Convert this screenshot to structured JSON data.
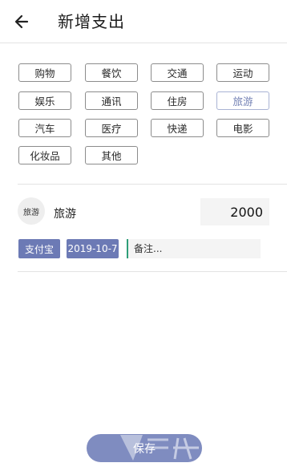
{
  "header": {
    "title": "新增支出",
    "back_icon": "arrow-left-icon"
  },
  "categories": [
    {
      "label": "购物",
      "selected": false
    },
    {
      "label": "餐饮",
      "selected": false
    },
    {
      "label": "交通",
      "selected": false
    },
    {
      "label": "运动",
      "selected": false
    },
    {
      "label": "娱乐",
      "selected": false
    },
    {
      "label": "通讯",
      "selected": false
    },
    {
      "label": "住房",
      "selected": false
    },
    {
      "label": "旅游",
      "selected": true
    },
    {
      "label": "汽车",
      "selected": false
    },
    {
      "label": "医疗",
      "selected": false
    },
    {
      "label": "快递",
      "selected": false
    },
    {
      "label": "电影",
      "selected": false
    },
    {
      "label": "化妆品",
      "selected": false
    },
    {
      "label": "其他",
      "selected": false
    }
  ],
  "selected": {
    "icon_text": "旅游",
    "name": "旅游",
    "amount": "2000"
  },
  "details": {
    "payment_method": "支付宝",
    "date": "2019-10-7",
    "note_placeholder": "备注..."
  },
  "save_label": "保存",
  "colors": {
    "accent": "#6c7ab5",
    "save_button": "#7f8cc0",
    "selected_category_text": "#7280b4"
  }
}
